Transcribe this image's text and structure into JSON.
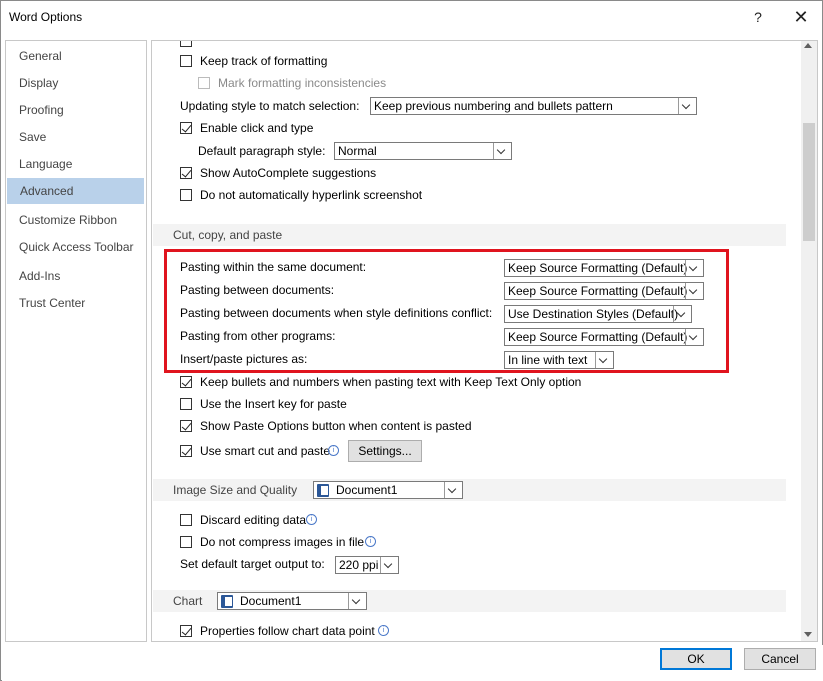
{
  "window": {
    "title": "Word Options",
    "help": "?",
    "close": "✕"
  },
  "nav": {
    "items": [
      {
        "label": "General"
      },
      {
        "label": "Display"
      },
      {
        "label": "Proofing"
      },
      {
        "label": "Save"
      },
      {
        "label": "Language"
      },
      {
        "label": "Advanced"
      },
      {
        "label": "Customize Ribbon"
      },
      {
        "label": "Quick Access Toolbar"
      },
      {
        "label": "Add-Ins"
      },
      {
        "label": "Trust Center"
      }
    ],
    "active": "Advanced"
  },
  "editing": {
    "keep_track": "Keep track of formatting",
    "mark_inconsistencies": "Mark formatting inconsistencies",
    "updating_style_label": "Updating style to match selection:",
    "updating_style_value": "Keep previous numbering and bullets pattern",
    "enable_click_type": "Enable click and type",
    "default_para_label": "Default paragraph style:",
    "default_para_value": "Normal",
    "show_autocomplete": "Show AutoComplete suggestions",
    "no_hyperlink": "Do not automatically hyperlink screenshot"
  },
  "cut_copy_paste": {
    "header": "Cut, copy, and paste",
    "rows": [
      {
        "label": "Pasting within the same document:",
        "value": "Keep Source Formatting (Default)"
      },
      {
        "label": "Pasting between documents:",
        "value": "Keep Source Formatting (Default)"
      },
      {
        "label": "Pasting between documents when style definitions conflict:",
        "value": "Use Destination Styles (Default)"
      },
      {
        "label": "Pasting from other programs:",
        "value": "Keep Source Formatting (Default)"
      },
      {
        "label": "Insert/paste pictures as:",
        "value": "In line with text"
      }
    ],
    "keep_bullets": "Keep bullets and numbers when pasting text with Keep Text Only option",
    "use_insert_key": "Use the Insert key for paste",
    "show_paste_options": "Show Paste Options button when content is pasted",
    "smart_cut": "Use smart cut and paste",
    "settings_button": "Settings..."
  },
  "image_size": {
    "header": "Image Size and Quality",
    "doc_value": "Document1",
    "discard_editing": "Discard editing data",
    "no_compress": "Do not compress images in file",
    "target_output_label": "Set default target output to:",
    "target_output_value": "220 ppi"
  },
  "chart": {
    "header": "Chart",
    "doc_value": "Document1",
    "follow_point": "Properties follow chart data point"
  },
  "footer": {
    "ok": "OK",
    "cancel": "Cancel"
  },
  "colors": {
    "accent": "#0078d7",
    "highlight_border": "#e0141e",
    "nav_active": "#b9d1ea"
  }
}
